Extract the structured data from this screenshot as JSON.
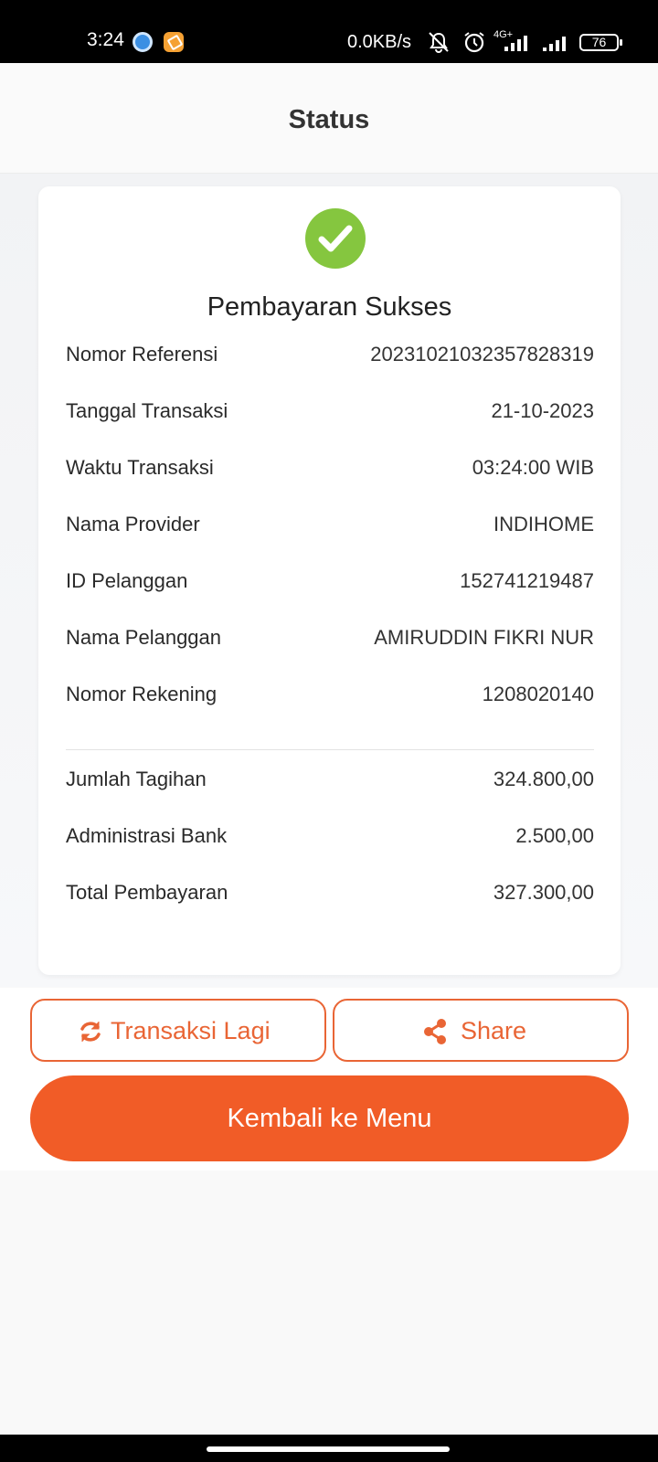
{
  "status_bar": {
    "time": "3:24",
    "net_speed": "0.0KB/s",
    "network_type": "4G+",
    "battery": "76",
    "icons": [
      "app-icon-blue",
      "app-icon-orange",
      "bell-muted-icon",
      "alarm-icon",
      "signal-icon",
      "signal-icon",
      "battery-icon"
    ]
  },
  "header": {
    "title": "Status"
  },
  "receipt": {
    "status_icon": "check-circle-icon",
    "title": "Pembayaran Sukses",
    "details": [
      {
        "label": "Nomor Referensi",
        "value": "20231021032357828319"
      },
      {
        "label": "Tanggal Transaksi",
        "value": "21-10-2023"
      },
      {
        "label": "Waktu Transaksi",
        "value": "03:24:00 WIB"
      },
      {
        "label": "Nama Provider",
        "value": "INDIHOME"
      },
      {
        "label": "ID Pelanggan",
        "value": "152741219487"
      },
      {
        "label": "Nama Pelanggan",
        "value": "AMIRUDDIN FIKRI NUR"
      },
      {
        "label": "Nomor Rekening",
        "value": "1208020140"
      }
    ],
    "amounts": [
      {
        "label": "Jumlah Tagihan",
        "value": "324.800,00"
      },
      {
        "label": "Administrasi Bank",
        "value": "2.500,00"
      },
      {
        "label": "Total Pembayaran",
        "value": "327.300,00"
      }
    ]
  },
  "actions": {
    "transact_again": {
      "label": "Transaksi Lagi",
      "icon": "refresh-icon"
    },
    "share": {
      "label": "Share",
      "icon": "share-icon"
    },
    "back_to_menu": {
      "label": "Kembali ke Menu"
    }
  },
  "colors": {
    "accent": "#f15c27",
    "success": "#85c63f"
  }
}
